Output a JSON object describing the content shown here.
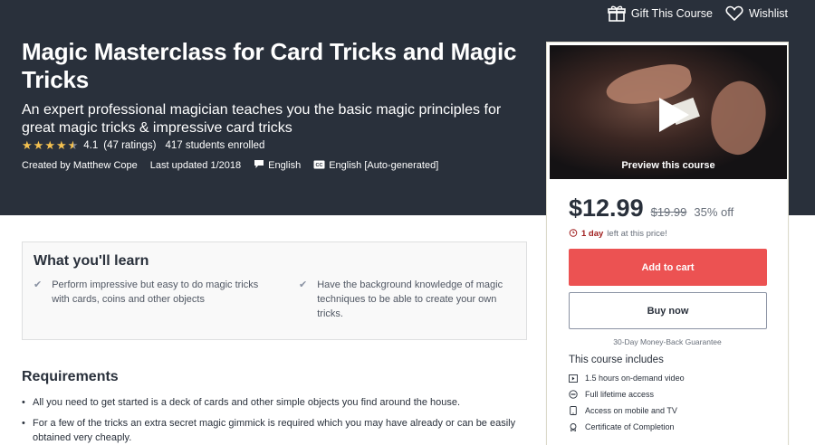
{
  "header": {
    "gift_label": "Gift This Course",
    "wishlist_label": "Wishlist"
  },
  "course": {
    "title": "Magic Masterclass for Card Tricks and Magic Tricks",
    "subtitle": "An expert professional magician teaches you the basic magic principles for great magic tricks & impressive card tricks",
    "rating": "4.1",
    "rating_count": "(47 ratings)",
    "stars": 4.1,
    "students": "417 students enrolled",
    "created_by": "Created by Matthew Cope",
    "last_updated": "Last updated 1/2018",
    "language": "English",
    "captions": "English [Auto-generated]"
  },
  "sidebar": {
    "preview_label": "Preview this course",
    "price": "$12.99",
    "original_price": "$19.99",
    "discount": "35% off",
    "deadline_bold": "1 day",
    "deadline_rest": "left at this price!",
    "add_to_cart": "Add to cart",
    "buy_now": "Buy now",
    "guarantee": "30-Day Money-Back Guarantee",
    "includes_title": "This course includes",
    "includes": [
      {
        "icon": "video-icon",
        "label": "1.5 hours on-demand video"
      },
      {
        "icon": "infinity-icon",
        "label": "Full lifetime access"
      },
      {
        "icon": "mobile-icon",
        "label": "Access on mobile and TV"
      },
      {
        "icon": "certificate-icon",
        "label": "Certificate of Completion"
      }
    ]
  },
  "learn": {
    "title": "What you'll learn",
    "items": [
      "Perform impressive but easy to do magic tricks with cards, coins and other objects",
      "Have the background knowledge of magic techniques to be able to create your own tricks."
    ]
  },
  "requirements": {
    "title": "Requirements",
    "items": [
      "All you need to get started is a deck of cards and other simple objects you find around the house.",
      "For a few of the tricks an extra secret magic gimmick is required which you may have already or can be easily obtained very cheaply."
    ]
  },
  "colors": {
    "hero_bg": "#29303b",
    "star": "#f4c150",
    "cart_button": "#ec5252",
    "deadline": "#a01e1e"
  }
}
